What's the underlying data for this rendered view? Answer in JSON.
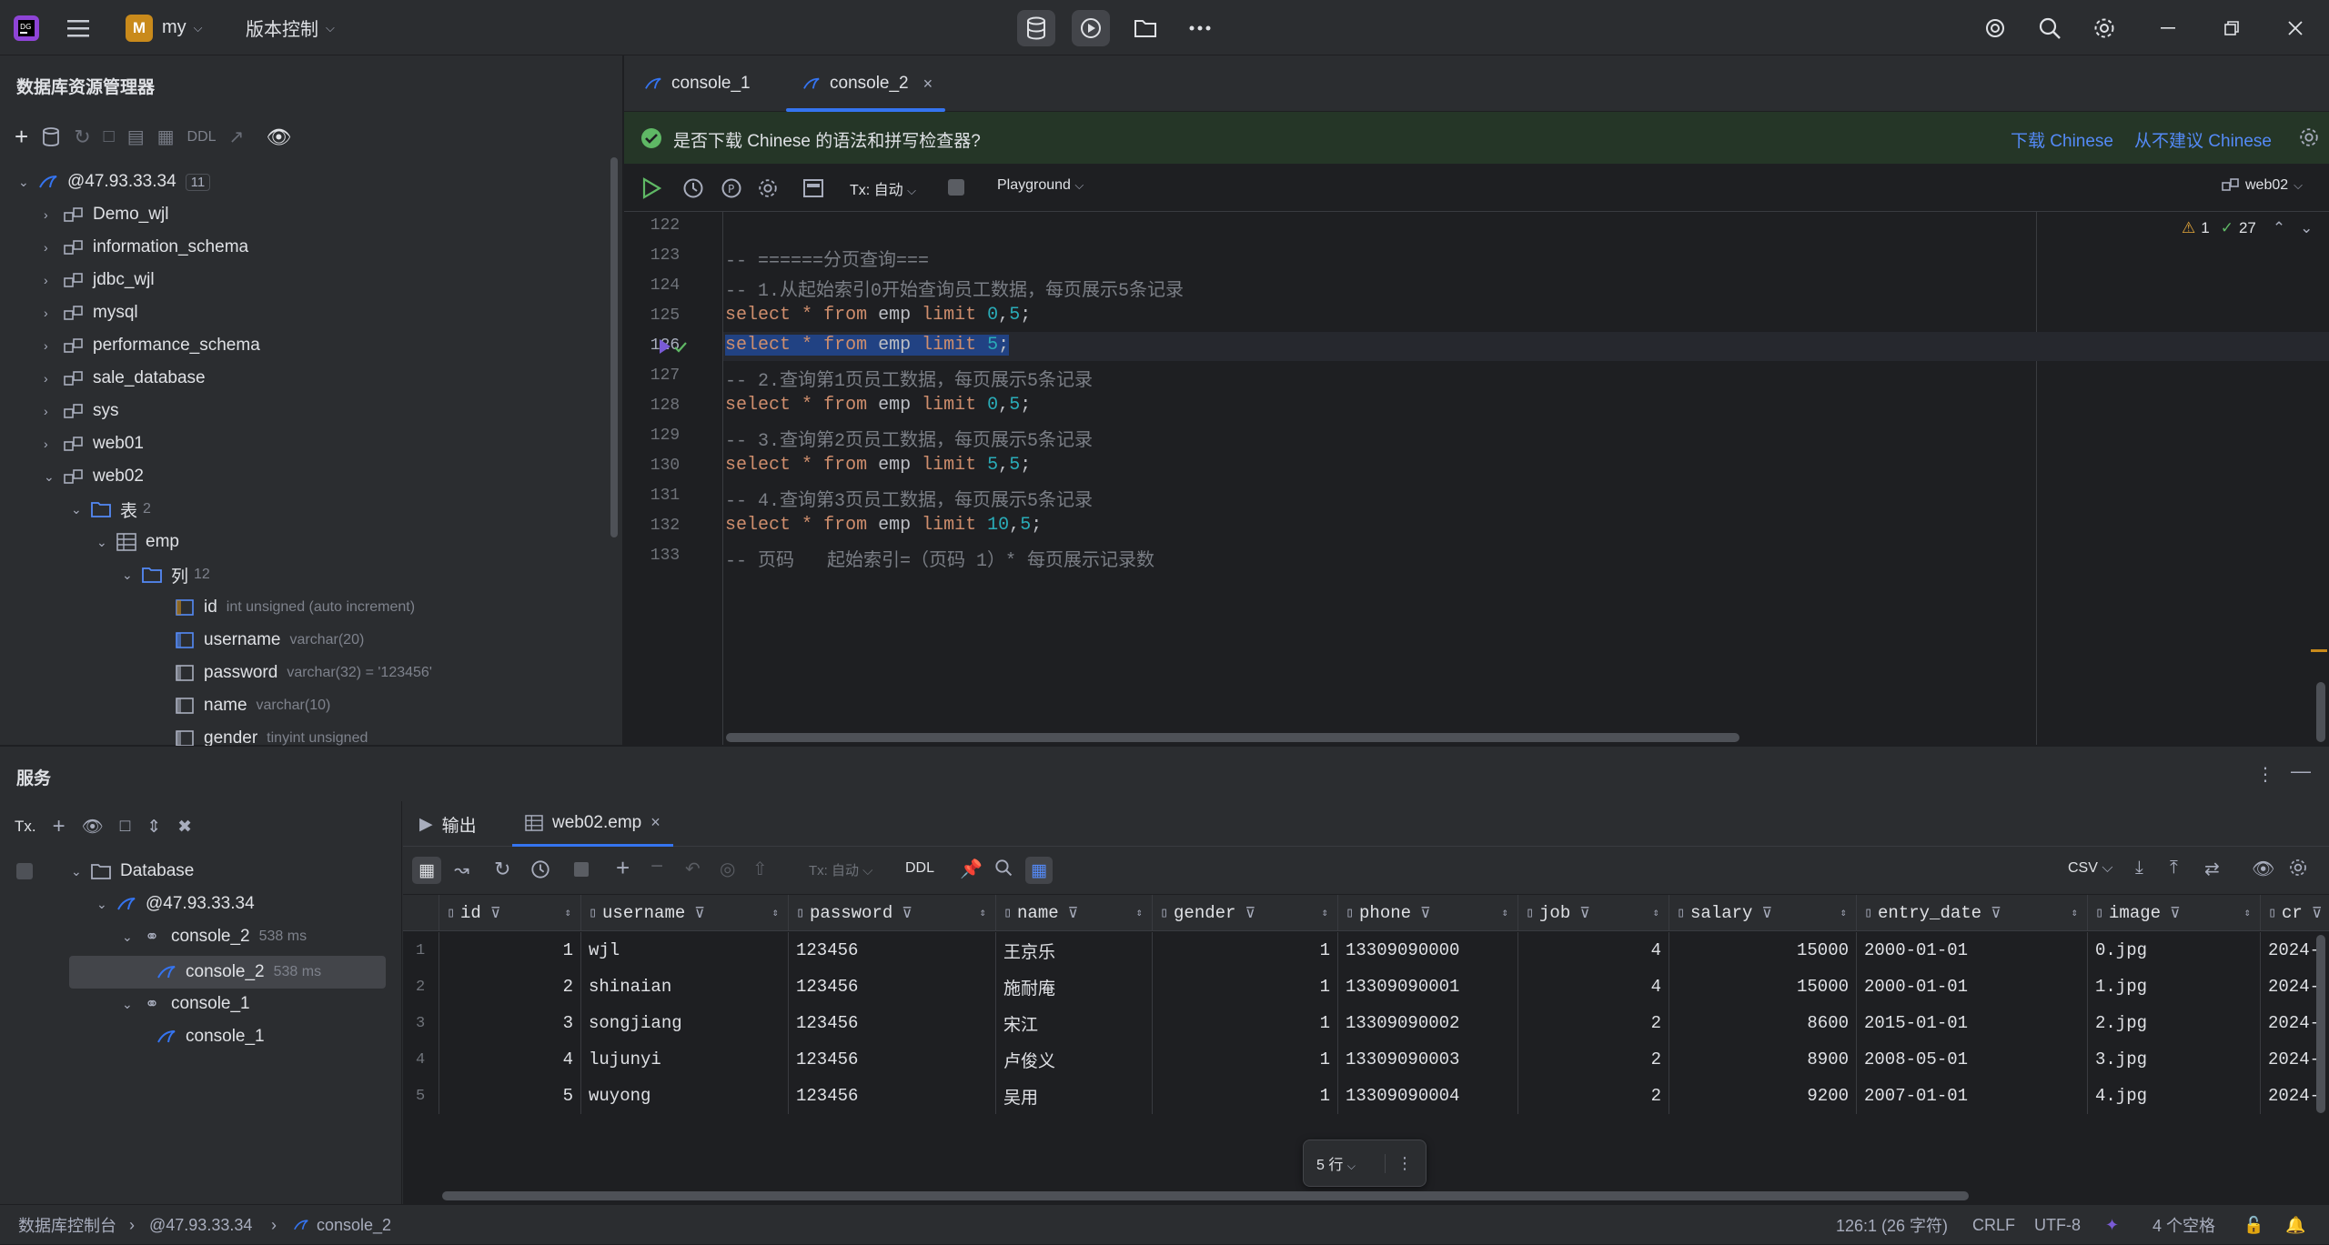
{
  "titlebar": {
    "project_initial": "M",
    "project_name": "my",
    "vcs_label": "版本控制"
  },
  "db_explorer": {
    "title": "数据库资源管理器",
    "ddl_label": "DDL",
    "host": "@47.93.33.34",
    "host_count": "11",
    "schemas": [
      "Demo_wjl",
      "information_schema",
      "jdbc_wjl",
      "mysql",
      "performance_schema",
      "sale_database",
      "sys",
      "web01",
      "web02"
    ],
    "tables_folder": "表",
    "tables_count": "2",
    "table_name": "emp",
    "columns_folder": "列",
    "columns_count": "12",
    "columns": [
      {
        "name": "id",
        "type": "int unsigned (auto increment)"
      },
      {
        "name": "username",
        "type": "varchar(20)"
      },
      {
        "name": "password",
        "type": "varchar(32) = '123456'"
      },
      {
        "name": "name",
        "type": "varchar(10)"
      },
      {
        "name": "gender",
        "type": "tinyint unsigned"
      }
    ]
  },
  "editor": {
    "tabs": [
      {
        "label": "console_1"
      },
      {
        "label": "console_2"
      }
    ],
    "notification": {
      "text": "是否下载 Chinese 的语法和拼写检查器?",
      "download": "下载 Chinese",
      "never": "从不建议 Chinese"
    },
    "toolbar": {
      "tx_label": "Tx: 自动",
      "playground": "Playground",
      "schema": "web02"
    },
    "inspections": {
      "warnings": "1",
      "ok": "27"
    },
    "line_numbers": [
      "122",
      "123",
      "124",
      "125",
      "126",
      "127",
      "128",
      "129",
      "130",
      "131",
      "132",
      "133"
    ],
    "lines": [
      "",
      "-- ======分页查询===",
      "-- 1.从起始索引0开始查询员工数据，每页展示5条记录",
      "select * from emp limit 0,5;",
      "select * from emp limit 5;",
      "-- 2.查询第1页员工数据，每页展示5条记录",
      "select * from emp limit 0,5;",
      "-- 3.查询第2页员工数据，每页展示5条记录",
      "select * from emp limit 5,5;",
      "-- 4.查询第3页员工数据，每页展示5条记录",
      "select * from emp limit 10,5;",
      "-- 页码   起始索引=（页码 1）* 每页展示记录数"
    ]
  },
  "services": {
    "title": "服务",
    "tx_label": "Tx.",
    "tree": {
      "database": "Database",
      "host": "@47.93.33.34",
      "console2_group": "console_2",
      "console2_group_time": "538 ms",
      "console2_item": "console_2",
      "console2_item_time": "538 ms",
      "console1_group": "console_1",
      "console1_item": "console_1"
    },
    "result_tabs": {
      "output": "输出",
      "table": "web02.emp"
    },
    "grid_toolbar": {
      "tx_label": "Tx: 自动",
      "ddl": "DDL",
      "export_format": "CSV"
    },
    "columns": [
      "id",
      "username",
      "password",
      "name",
      "gender",
      "phone",
      "job",
      "salary",
      "entry_date",
      "image",
      "cr"
    ],
    "rows": [
      {
        "n": "1",
        "cells": [
          "1",
          "wjl",
          "123456",
          "王京乐",
          "1",
          "13309090000",
          "4",
          "15000",
          "2000-01-01",
          "0.jpg",
          "2024-"
        ]
      },
      {
        "n": "2",
        "cells": [
          "2",
          "shinaian",
          "123456",
          "施耐庵",
          "1",
          "13309090001",
          "4",
          "15000",
          "2000-01-01",
          "1.jpg",
          "2024-"
        ]
      },
      {
        "n": "3",
        "cells": [
          "3",
          "songjiang",
          "123456",
          "宋江",
          "1",
          "13309090002",
          "2",
          "8600",
          "2015-01-01",
          "2.jpg",
          "2024-"
        ]
      },
      {
        "n": "4",
        "cells": [
          "4",
          "lujunyi",
          "123456",
          "卢俊义",
          "1",
          "13309090003",
          "2",
          "8900",
          "2008-05-01",
          "3.jpg",
          "2024-"
        ]
      },
      {
        "n": "5",
        "cells": [
          "5",
          "wuyong",
          "123456",
          "吴用",
          "1",
          "13309090004",
          "2",
          "9200",
          "2007-01-01",
          "4.jpg",
          "2024-"
        ]
      }
    ],
    "row_count": "5 行"
  },
  "statusbar": {
    "crumb1": "数据库控制台",
    "crumb2": "@47.93.33.34",
    "crumb3": "console_2",
    "position": "126:1 (26 字符)",
    "line_sep": "CRLF",
    "encoding": "UTF-8",
    "indent": "4 个空格"
  },
  "colors": {
    "accent": "#3574f0",
    "notify_bg": "#253627",
    "keyword": "#cf8e6d",
    "number": "#2aacb8",
    "comment": "#7a7e85",
    "selection": "#214283"
  }
}
